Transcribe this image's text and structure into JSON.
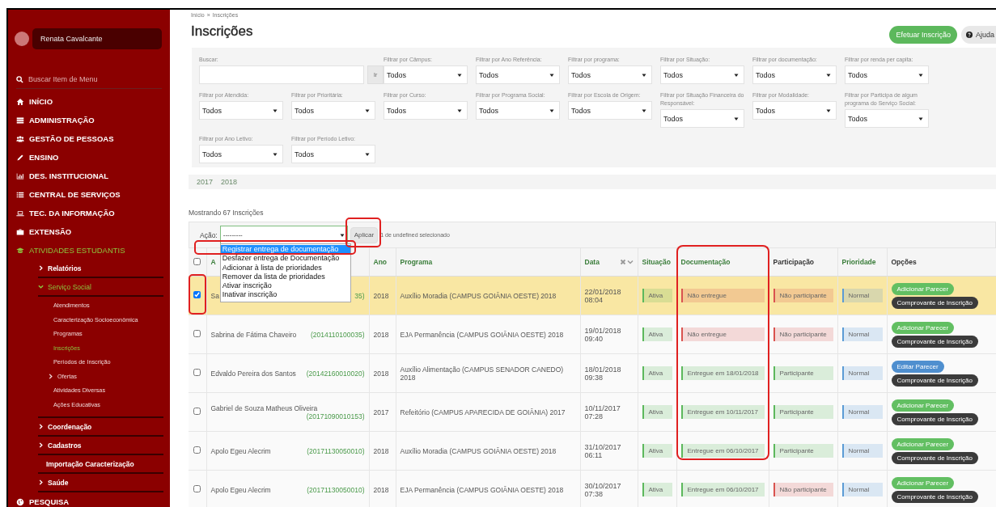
{
  "sidebar": {
    "user": {
      "name": "Renata Cavalcante"
    },
    "search": {
      "placeholder": "Buscar Item de Menu"
    },
    "menu": [
      {
        "label": "INÍCIO",
        "selected": false
      },
      {
        "label": "ADMINISTRAÇÃO",
        "selected": false
      },
      {
        "label": "GESTÃO DE PESSOAS",
        "selected": false
      },
      {
        "label": "ENSINO",
        "selected": false
      },
      {
        "label": "DES. INSTITUCIONAL",
        "selected": false
      },
      {
        "label": "CENTRAL DE SERVIÇOS",
        "selected": false
      },
      {
        "label": "TEC. DA INFORMAÇÃO",
        "selected": false
      },
      {
        "label": "EXTENSÃO",
        "selected": false
      },
      {
        "label": "ATIVIDADES ESTUDANTIS",
        "selected": true,
        "children": [
          {
            "label": "Relatórios",
            "kind": "group",
            "selected": false,
            "expanded": false
          },
          {
            "label": "Serviço Social",
            "kind": "group",
            "selected": true,
            "expanded": true,
            "children": [
              {
                "label": "Atendimentos",
                "kind": "link",
                "selected": false
              },
              {
                "label": "Caracterização Socioeconômica",
                "kind": "link",
                "selected": false
              },
              {
                "label": "Programas",
                "kind": "link",
                "selected": false
              },
              {
                "label": "Inscrições",
                "kind": "link",
                "selected": true
              },
              {
                "label": "Períodos de Inscrição",
                "kind": "link",
                "selected": false
              },
              {
                "label": "Ofertas",
                "kind": "group",
                "selected": false,
                "expanded": false
              },
              {
                "label": "Atividades Diversas",
                "kind": "link",
                "selected": false
              },
              {
                "label": "Ações Educativas",
                "kind": "link",
                "selected": false
              }
            ]
          },
          {
            "label": "Coordenação",
            "kind": "group",
            "selected": false,
            "expanded": false
          },
          {
            "label": "Cadastros",
            "kind": "group",
            "selected": false,
            "expanded": false
          },
          {
            "label": "Importação Caracterização",
            "kind": "link",
            "selected": false
          },
          {
            "label": "Saúde",
            "kind": "group",
            "selected": false,
            "expanded": false
          }
        ]
      },
      {
        "label": "PESQUISA",
        "selected": false
      }
    ]
  },
  "breadcrumb": {
    "items": [
      "Início",
      "Inscrições"
    ],
    "separator": "»"
  },
  "title": "Inscrições",
  "header_buttons": [
    {
      "label": "Efetuar Inscrição",
      "kind": "primary"
    },
    {
      "label": "Ajuda",
      "kind": "help"
    }
  ],
  "filters": {
    "search": {
      "label": "Buscar:",
      "button": "Ir"
    },
    "selects": [
      {
        "label": "Filtrar por Câmpus:",
        "value": "Todos"
      },
      {
        "label": "Filtrar por Ano Referência:",
        "value": "Todos"
      },
      {
        "label": "Filtrar por programa:",
        "value": "Todos"
      },
      {
        "label": "Filtrar por Situação:",
        "value": "Todos"
      },
      {
        "label": "Filtrar por documentação:",
        "value": "Todos"
      },
      {
        "label": "Filtrar por renda per capita:",
        "value": "Todos"
      },
      {
        "label": "Filtrar por Atendida:",
        "value": "Todos"
      },
      {
        "label": "Filtrar por Prioritária:",
        "value": "Todos"
      },
      {
        "label": "Filtrar por Curso:",
        "value": "Todos"
      },
      {
        "label": "Filtrar por Programa Social:",
        "value": "Todos"
      },
      {
        "label": "Filtrar por Escola de Origem:",
        "value": "Todos"
      },
      {
        "label": "Filtrar por Situação Financeira do Responsável:",
        "value": "Todos"
      },
      {
        "label": "Filtrar por Modalidade:",
        "value": "Todos"
      },
      {
        "label": "Filtrar por Participa de algum programa do Serviço Social:",
        "value": "Todos"
      },
      {
        "label": "Filtrar por Ano Letivo:",
        "value": "Todos"
      },
      {
        "label": "Filtrar por Período Letivo:",
        "value": "Todos"
      }
    ]
  },
  "year_tabs": [
    "2017",
    "2018"
  ],
  "count_text": "Mostrando 67 Inscrições",
  "actions": {
    "label": "Ação:",
    "value": "---------",
    "apply": {
      "label": "Aplicar",
      "highlighted": true
    },
    "selection_text": "1 de undefined selecionado",
    "options": [
      {
        "label": "Registrar entrega de documentação",
        "selected": true,
        "highlighted": true
      },
      {
        "label": "Desfazer entrega de Documentação",
        "selected": false,
        "highlighted": false
      },
      {
        "label": "Adicionar à lista de prioridades",
        "selected": false,
        "highlighted": false
      },
      {
        "label": "Remover da lista de prioridades",
        "selected": false,
        "highlighted": false
      },
      {
        "label": "Ativar inscrição",
        "selected": false,
        "highlighted": false
      },
      {
        "label": "Inativar inscrição",
        "selected": false,
        "highlighted": false
      }
    ]
  },
  "table": {
    "all_checked": false,
    "columns": [
      {
        "label": "A",
        "sortable": true,
        "highlighted": false
      },
      {
        "label": "Ano",
        "sortable": true,
        "highlighted": false
      },
      {
        "label": "Programa",
        "sortable": true,
        "highlighted": false
      },
      {
        "label": "Data",
        "sortable": true,
        "highlighted": false
      },
      {
        "label": "Situação",
        "sortable": true,
        "highlighted": false
      },
      {
        "label": "Documentação",
        "sortable": true,
        "highlighted": true
      },
      {
        "label": "Participação",
        "sortable": false,
        "highlighted": false
      },
      {
        "label": "Prioridade",
        "sortable": true,
        "highlighted": false
      },
      {
        "label": "Opções",
        "sortable": false,
        "highlighted": false
      }
    ],
    "rows": [
      {
        "selected": true,
        "checked": true,
        "checkbox_highlighted": true,
        "student": "Sa",
        "id": "35)",
        "year": "2018",
        "program": "Auxílio Moradia (CAMPUS GOIÂNIA OESTE) 2018",
        "date": "22/01/2018",
        "time": "08:04",
        "situation": {
          "label": "Ativa",
          "color": "#5cb85c"
        },
        "documentation": {
          "label": "Não entregue",
          "color": "#d9534f",
          "highlighted": true
        },
        "participation": {
          "label": "Não participante",
          "color": "#d9534f"
        },
        "priority": {
          "label": "Normal",
          "color": "#5b9bd5"
        },
        "options": [
          {
            "label": "Adicionar Parecer",
            "kind": "add"
          },
          {
            "label": "Comprovante de Inscrição",
            "kind": "receipt"
          }
        ]
      },
      {
        "selected": false,
        "checked": false,
        "checkbox_highlighted": false,
        "student": "Sabrina de Fátima Chaveiro",
        "id": "(2014110100035)",
        "year": "2018",
        "program": "EJA Permanência (CAMPUS GOIÂNIA OESTE) 2018",
        "date": "19/01/2018",
        "time": "09:40",
        "situation": {
          "label": "Ativa",
          "color": "#5cb85c"
        },
        "documentation": {
          "label": "Não entregue",
          "color": "#d9534f",
          "highlighted": true
        },
        "participation": {
          "label": "Não participante",
          "color": "#d9534f"
        },
        "priority": {
          "label": "Normal",
          "color": "#5b9bd5"
        },
        "options": [
          {
            "label": "Adicionar Parecer",
            "kind": "add"
          },
          {
            "label": "Comprovante de Inscrição",
            "kind": "receipt"
          }
        ]
      },
      {
        "selected": false,
        "checked": false,
        "checkbox_highlighted": false,
        "student": "Edvaldo Pereira dos Santos",
        "id": "(20142160010020)",
        "year": "2018",
        "program": "Auxílio Alimentação (CAMPUS SENADOR CANEDO) 2018",
        "date": "18/01/2018",
        "time": "09:38",
        "situation": {
          "label": "Ativa",
          "color": "#5cb85c"
        },
        "documentation": {
          "label": "Entregue em 18/01/2018",
          "color": "#5cb85c",
          "highlighted": true
        },
        "participation": {
          "label": "Participante",
          "color": "#5cb85c"
        },
        "priority": {
          "label": "Normal",
          "color": "#5b9bd5"
        },
        "options": [
          {
            "label": "Editar Parecer",
            "kind": "edit"
          },
          {
            "label": "Comprovante de Inscrição",
            "kind": "receipt"
          }
        ]
      },
      {
        "selected": false,
        "checked": false,
        "checkbox_highlighted": false,
        "student": "Gabriel de Souza Matheus Oliveira",
        "id": "(20171090010153)",
        "year": "2017",
        "program": "Refeitório (CAMPUS APARECIDA DE GOIÂNIA) 2017",
        "date": "10/11/2017",
        "time": "07:28",
        "situation": {
          "label": "Ativa",
          "color": "#5cb85c"
        },
        "documentation": {
          "label": "Entregue em 10/11/2017",
          "color": "#5cb85c",
          "highlighted": true
        },
        "participation": {
          "label": "Participante",
          "color": "#5cb85c"
        },
        "priority": {
          "label": "Normal",
          "color": "#5b9bd5"
        },
        "options": [
          {
            "label": "Adicionar Parecer",
            "kind": "add"
          },
          {
            "label": "Comprovante de Inscrição",
            "kind": "receipt"
          }
        ]
      },
      {
        "selected": false,
        "checked": false,
        "checkbox_highlighted": false,
        "student": "Apolo Egeu Alecrim",
        "id": "(20171130050010)",
        "year": "2018",
        "program": "Auxílio Moradia (CAMPUS GOIÂNIA OESTE) 2018",
        "date": "31/10/2017",
        "time": "06:11",
        "situation": {
          "label": "Ativa",
          "color": "#5cb85c"
        },
        "documentation": {
          "label": "Entregue em 06/10/2017",
          "color": "#5cb85c",
          "highlighted": true
        },
        "participation": {
          "label": "Participante",
          "color": "#5cb85c"
        },
        "priority": {
          "label": "Normal",
          "color": "#5b9bd5"
        },
        "options": [
          {
            "label": "Adicionar Parecer",
            "kind": "add"
          },
          {
            "label": "Comprovante de Inscrição",
            "kind": "receipt"
          }
        ]
      },
      {
        "selected": false,
        "checked": false,
        "checkbox_highlighted": false,
        "student": "Apolo Egeu Alecrim",
        "id": "(20171130050010)",
        "year": "2018",
        "program": "EJA Permanência (CAMPUS GOIÂNIA OESTE) 2018",
        "date": "30/10/2017",
        "time": "07:38",
        "situation": {
          "label": "Ativa",
          "color": "#5cb85c"
        },
        "documentation": {
          "label": "Entregue em 06/10/2017",
          "color": "#5cb85c",
          "highlighted": false
        },
        "participation": {
          "label": "Não participante",
          "color": "#d9534f"
        },
        "priority": {
          "label": "Normal",
          "color": "#5b9bd5"
        },
        "options": [
          {
            "label": "Adicionar Parecer",
            "kind": "add"
          },
          {
            "label": "Comprovante de Inscrição",
            "kind": "receipt"
          }
        ]
      }
    ]
  }
}
